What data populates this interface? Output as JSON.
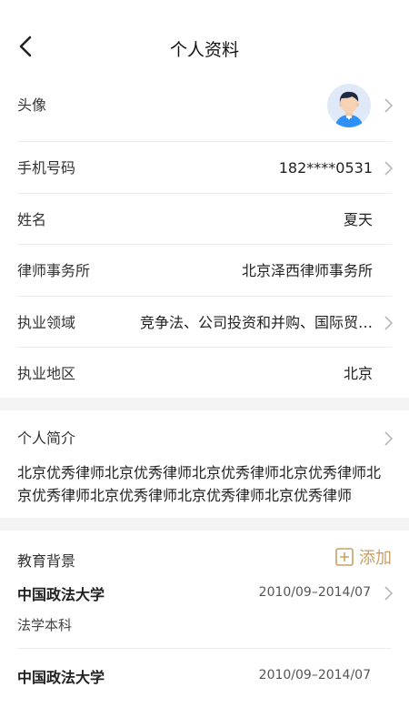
{
  "header": {
    "back_icon": "chevron-left-icon",
    "title": "个人资料"
  },
  "profile": {
    "avatar": {
      "label": "头像",
      "icon": "user-avatar-icon"
    },
    "phone": {
      "label": "手机号码",
      "value": "182****0531"
    },
    "name": {
      "label": "姓名",
      "value": "夏天"
    },
    "firm": {
      "label": "律师事务所",
      "value": "北京泽西律师事务所"
    },
    "practice_area": {
      "label": "执业领域",
      "value": "竞争法、公司投资和并购、国际贸…"
    },
    "practice_region": {
      "label": "执业地区",
      "value": "北京"
    }
  },
  "bio": {
    "label": "个人简介",
    "text": "北京优秀律师北京优秀律师北京优秀律师北京优秀律师北京优秀律师北京优秀律师北京优秀律师北京优秀律师"
  },
  "education": {
    "label": "教育背景",
    "add_label": "添加",
    "items": [
      {
        "school": "中国政法大学",
        "dates": "2010/09–2014/07",
        "degree": "法学本科"
      },
      {
        "school": "中国政法大学",
        "dates": "2010/09–2014/07"
      }
    ]
  },
  "colors": {
    "accent": "#c9a063",
    "divider": "#ededed",
    "section_gap": "#f4f4f4",
    "avatar_bg": "#dfe9f8"
  }
}
